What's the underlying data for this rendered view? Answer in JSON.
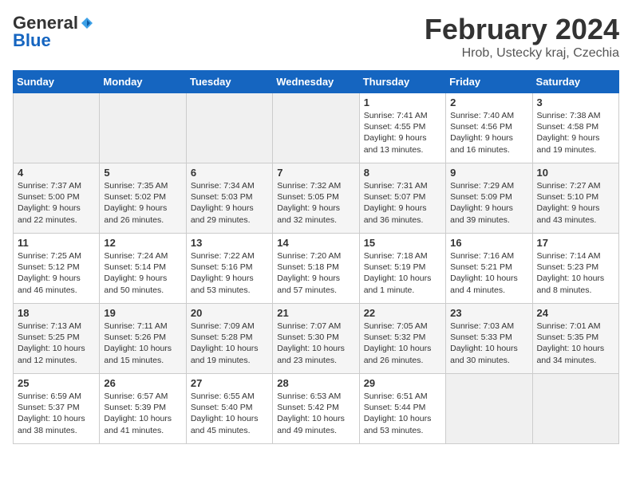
{
  "header": {
    "logo_general": "General",
    "logo_blue": "Blue",
    "title": "February 2024",
    "subtitle": "Hrob, Ustecky kraj, Czechia"
  },
  "days_of_week": [
    "Sunday",
    "Monday",
    "Tuesday",
    "Wednesday",
    "Thursday",
    "Friday",
    "Saturday"
  ],
  "weeks": [
    [
      {
        "day": "",
        "info": ""
      },
      {
        "day": "",
        "info": ""
      },
      {
        "day": "",
        "info": ""
      },
      {
        "day": "",
        "info": ""
      },
      {
        "day": "1",
        "info": "Sunrise: 7:41 AM\nSunset: 4:55 PM\nDaylight: 9 hours\nand 13 minutes."
      },
      {
        "day": "2",
        "info": "Sunrise: 7:40 AM\nSunset: 4:56 PM\nDaylight: 9 hours\nand 16 minutes."
      },
      {
        "day": "3",
        "info": "Sunrise: 7:38 AM\nSunset: 4:58 PM\nDaylight: 9 hours\nand 19 minutes."
      }
    ],
    [
      {
        "day": "4",
        "info": "Sunrise: 7:37 AM\nSunset: 5:00 PM\nDaylight: 9 hours\nand 22 minutes."
      },
      {
        "day": "5",
        "info": "Sunrise: 7:35 AM\nSunset: 5:02 PM\nDaylight: 9 hours\nand 26 minutes."
      },
      {
        "day": "6",
        "info": "Sunrise: 7:34 AM\nSunset: 5:03 PM\nDaylight: 9 hours\nand 29 minutes."
      },
      {
        "day": "7",
        "info": "Sunrise: 7:32 AM\nSunset: 5:05 PM\nDaylight: 9 hours\nand 32 minutes."
      },
      {
        "day": "8",
        "info": "Sunrise: 7:31 AM\nSunset: 5:07 PM\nDaylight: 9 hours\nand 36 minutes."
      },
      {
        "day": "9",
        "info": "Sunrise: 7:29 AM\nSunset: 5:09 PM\nDaylight: 9 hours\nand 39 minutes."
      },
      {
        "day": "10",
        "info": "Sunrise: 7:27 AM\nSunset: 5:10 PM\nDaylight: 9 hours\nand 43 minutes."
      }
    ],
    [
      {
        "day": "11",
        "info": "Sunrise: 7:25 AM\nSunset: 5:12 PM\nDaylight: 9 hours\nand 46 minutes."
      },
      {
        "day": "12",
        "info": "Sunrise: 7:24 AM\nSunset: 5:14 PM\nDaylight: 9 hours\nand 50 minutes."
      },
      {
        "day": "13",
        "info": "Sunrise: 7:22 AM\nSunset: 5:16 PM\nDaylight: 9 hours\nand 53 minutes."
      },
      {
        "day": "14",
        "info": "Sunrise: 7:20 AM\nSunset: 5:18 PM\nDaylight: 9 hours\nand 57 minutes."
      },
      {
        "day": "15",
        "info": "Sunrise: 7:18 AM\nSunset: 5:19 PM\nDaylight: 10 hours\nand 1 minute."
      },
      {
        "day": "16",
        "info": "Sunrise: 7:16 AM\nSunset: 5:21 PM\nDaylight: 10 hours\nand 4 minutes."
      },
      {
        "day": "17",
        "info": "Sunrise: 7:14 AM\nSunset: 5:23 PM\nDaylight: 10 hours\nand 8 minutes."
      }
    ],
    [
      {
        "day": "18",
        "info": "Sunrise: 7:13 AM\nSunset: 5:25 PM\nDaylight: 10 hours\nand 12 minutes."
      },
      {
        "day": "19",
        "info": "Sunrise: 7:11 AM\nSunset: 5:26 PM\nDaylight: 10 hours\nand 15 minutes."
      },
      {
        "day": "20",
        "info": "Sunrise: 7:09 AM\nSunset: 5:28 PM\nDaylight: 10 hours\nand 19 minutes."
      },
      {
        "day": "21",
        "info": "Sunrise: 7:07 AM\nSunset: 5:30 PM\nDaylight: 10 hours\nand 23 minutes."
      },
      {
        "day": "22",
        "info": "Sunrise: 7:05 AM\nSunset: 5:32 PM\nDaylight: 10 hours\nand 26 minutes."
      },
      {
        "day": "23",
        "info": "Sunrise: 7:03 AM\nSunset: 5:33 PM\nDaylight: 10 hours\nand 30 minutes."
      },
      {
        "day": "24",
        "info": "Sunrise: 7:01 AM\nSunset: 5:35 PM\nDaylight: 10 hours\nand 34 minutes."
      }
    ],
    [
      {
        "day": "25",
        "info": "Sunrise: 6:59 AM\nSunset: 5:37 PM\nDaylight: 10 hours\nand 38 minutes."
      },
      {
        "day": "26",
        "info": "Sunrise: 6:57 AM\nSunset: 5:39 PM\nDaylight: 10 hours\nand 41 minutes."
      },
      {
        "day": "27",
        "info": "Sunrise: 6:55 AM\nSunset: 5:40 PM\nDaylight: 10 hours\nand 45 minutes."
      },
      {
        "day": "28",
        "info": "Sunrise: 6:53 AM\nSunset: 5:42 PM\nDaylight: 10 hours\nand 49 minutes."
      },
      {
        "day": "29",
        "info": "Sunrise: 6:51 AM\nSunset: 5:44 PM\nDaylight: 10 hours\nand 53 minutes."
      },
      {
        "day": "",
        "info": ""
      },
      {
        "day": "",
        "info": ""
      }
    ]
  ]
}
